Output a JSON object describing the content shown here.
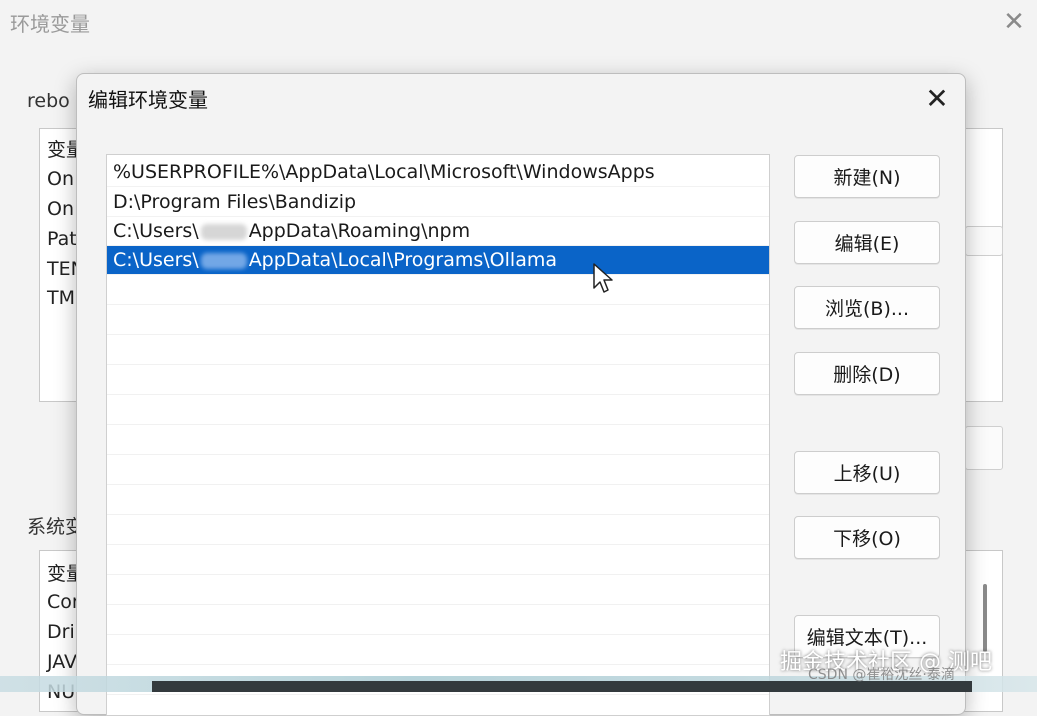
{
  "background_window": {
    "title": "环境变量",
    "close_glyph": "✕",
    "user_section_label": "rebo",
    "user_list": {
      "header": "变量",
      "items": [
        "On",
        "On",
        "Pat",
        "TEN",
        "TM"
      ]
    },
    "system_section_label": "系统变",
    "system_list": {
      "header": "变量",
      "items": [
        "Cor",
        "Dri",
        "JAV",
        "NU"
      ]
    }
  },
  "dialog": {
    "title": "编辑环境变量",
    "close_glyph": "✕",
    "paths": [
      {
        "text": "%USERPROFILE%\\AppData\\Local\\Microsoft\\WindowsApps",
        "selected": false,
        "redacted": false
      },
      {
        "text": "D:\\Program Files\\Bandizip",
        "selected": false,
        "redacted": false
      },
      {
        "prefix": "C:\\Users\\",
        "suffix": "AppData\\Roaming\\npm",
        "selected": false,
        "redacted": true
      },
      {
        "prefix": "C:\\Users\\",
        "suffix": "AppData\\Local\\Programs\\Ollama",
        "selected": true,
        "redacted": true
      }
    ],
    "buttons": {
      "new": "新建(N)",
      "edit": "编辑(E)",
      "browse": "浏览(B)...",
      "delete": "删除(D)",
      "move_up": "上移(U)",
      "move_down": "下移(O)",
      "edit_text": "编辑文本(T)..."
    }
  },
  "watermark": {
    "main": "掘金技术社区 @ 测吧",
    "small": "CSDN @崔裕沈丝·泰滴"
  },
  "colors": {
    "selection": "#0a64c8",
    "window_bg": "#f3f3f3"
  },
  "icons": {
    "cursor": "arrow-cursor-icon",
    "close": "close-icon"
  }
}
